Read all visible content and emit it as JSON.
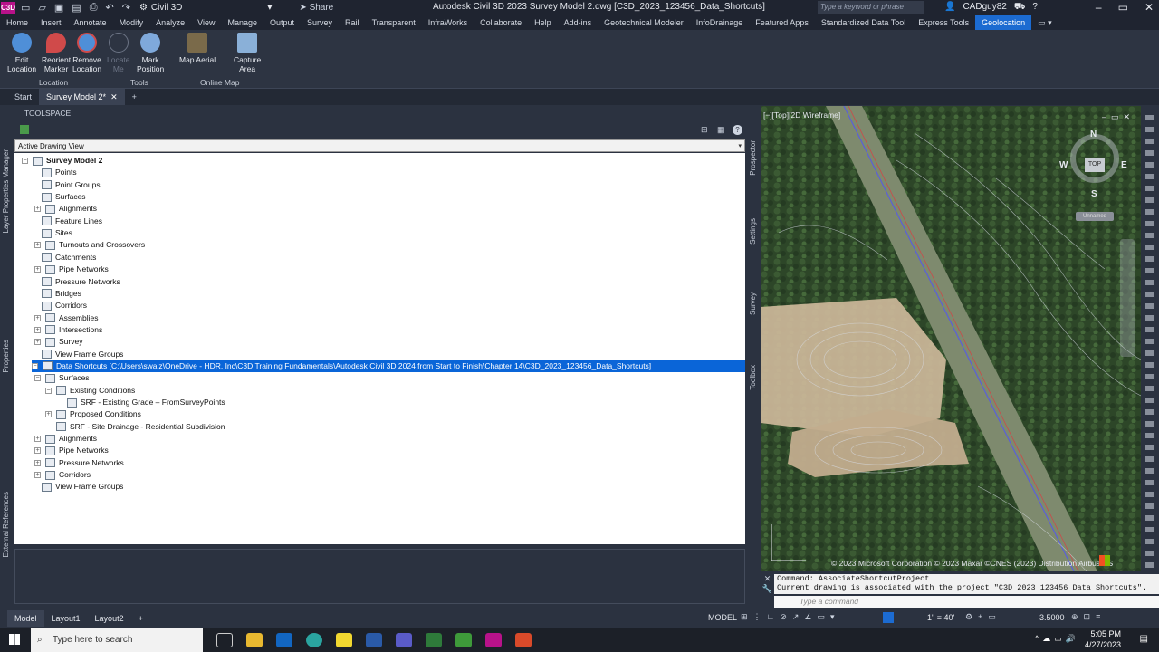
{
  "title_bar": {
    "logo": "C3D",
    "workspace": "Civil 3D",
    "share": "Share",
    "app_title": "Autodesk Civil 3D 2023   Survey Model 2.dwg [C3D_2023_123456_Data_Shortcuts]",
    "search_placeholder": "Type a keyword or phrase",
    "user": "CADguy82"
  },
  "menu_tabs": [
    "Home",
    "Insert",
    "Annotate",
    "Modify",
    "Analyze",
    "View",
    "Manage",
    "Output",
    "Survey",
    "Rail",
    "Transparent",
    "InfraWorks",
    "Collaborate",
    "Help",
    "Add-ins",
    "Geotechnical Modeler",
    "InfoDrainage",
    "Featured Apps",
    "Standardized Data Tool",
    "Express Tools",
    "Geolocation"
  ],
  "active_menu_tab": "Geolocation",
  "ribbon": {
    "buttons": [
      {
        "label1": "Edit",
        "label2": "Location"
      },
      {
        "label1": "Reorient",
        "label2": "Marker"
      },
      {
        "label1": "Remove",
        "label2": "Location"
      },
      {
        "label1": "Locate",
        "label2": "Me"
      },
      {
        "label1": "Mark",
        "label2": "Position"
      },
      {
        "label1": "Map Aerial",
        "label2": ""
      },
      {
        "label1": "Capture",
        "label2": "Area"
      }
    ],
    "groups": [
      "Location",
      "Tools",
      "Online Map"
    ]
  },
  "doc_tabs": [
    "Start",
    "Survey Model 2*"
  ],
  "toolspace": {
    "title": "TOOLSPACE",
    "view_select": "Active Drawing View",
    "side_tabs_left": [
      "Layer Properties Manager",
      "Properties",
      "External References"
    ],
    "side_tabs_right": [
      "Prospector",
      "Settings",
      "Survey",
      "Toolbox"
    ]
  },
  "tree": [
    {
      "label": "Survey Model 2",
      "bold": true
    },
    {
      "label": "Points"
    },
    {
      "label": "Point Groups"
    },
    {
      "label": "Surfaces"
    },
    {
      "label": "Alignments"
    },
    {
      "label": "Feature Lines"
    },
    {
      "label": "Sites"
    },
    {
      "label": "Turnouts and Crossovers"
    },
    {
      "label": "Catchments"
    },
    {
      "label": "Pipe Networks"
    },
    {
      "label": "Pressure Networks"
    },
    {
      "label": "Bridges"
    },
    {
      "label": "Corridors"
    },
    {
      "label": "Assemblies"
    },
    {
      "label": "Intersections"
    },
    {
      "label": "Survey"
    },
    {
      "label": "View Frame Groups"
    },
    {
      "label": "Data Shortcuts [C:\\Users\\swalz\\OneDrive - HDR, Inc\\C3D Training Fundamentals\\Autodesk Civil 3D 2024 from Start to Finish\\Chapter 14\\C3D_2023_123456_Data_Shortcuts]",
      "selected": true
    },
    {
      "label": "Surfaces"
    },
    {
      "label": "Existing Conditions"
    },
    {
      "label": "SRF - Existing Grade – FromSurveyPoints"
    },
    {
      "label": "Proposed Conditions"
    },
    {
      "label": "SRF - Site Drainage - Residential Subdivision"
    },
    {
      "label": "Alignments"
    },
    {
      "label": "Pipe Networks"
    },
    {
      "label": "Pressure Networks"
    },
    {
      "label": "Corridors"
    },
    {
      "label": "View Frame Groups"
    }
  ],
  "viewport": {
    "label": "[−][Top][2D Wireframe]",
    "compass": {
      "n": "N",
      "s": "S",
      "e": "E",
      "w": "W",
      "top": "TOP"
    },
    "unnamed": "Unnamed",
    "copyright": "© 2023 Microsoft Corporation © 2023 Maxar ©CNES (2023) Distribution Airbus DS"
  },
  "command": {
    "line1": "Command: AssociateShortcutProject",
    "line2": "Current drawing is associated with the project \"C3D_2023_123456_Data_Shortcuts\".",
    "placeholder": "Type a command"
  },
  "layout_tabs": [
    "Model",
    "Layout1",
    "Layout2"
  ],
  "status": {
    "model": "MODEL",
    "scale": "1\" = 40'",
    "value": "3.5000"
  },
  "taskbar": {
    "search": "Type here to search",
    "time": "5:05 PM",
    "date": "4/27/2023"
  }
}
